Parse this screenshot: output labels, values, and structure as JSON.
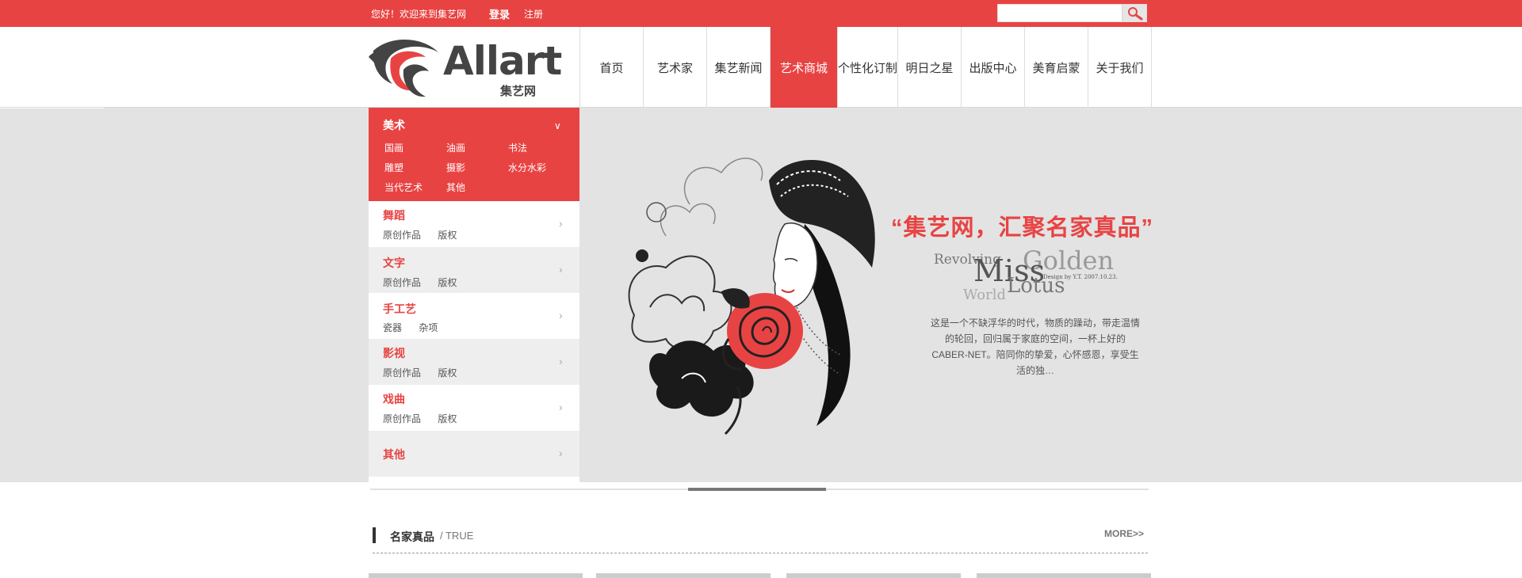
{
  "topbar": {
    "welcome": "您好！欢迎来到集艺网",
    "login": "登录",
    "register": "注册",
    "search_placeholder": ""
  },
  "logo": {
    "name": "Allart",
    "sub": "集艺网"
  },
  "nav": {
    "items": [
      {
        "label": "首页",
        "active": false
      },
      {
        "label": "艺术家",
        "active": false
      },
      {
        "label": "集艺新闻",
        "active": false
      },
      {
        "label": "艺术商城",
        "active": true
      },
      {
        "label": "个性化订制",
        "active": false
      },
      {
        "label": "明日之星",
        "active": false
      },
      {
        "label": "出版中心",
        "active": false
      },
      {
        "label": "美育启蒙",
        "active": false
      },
      {
        "label": "关于我们",
        "active": false
      }
    ]
  },
  "sidebar": {
    "main": {
      "title": "美术",
      "subs": [
        "国画",
        "油画",
        "书法",
        "雕塑",
        "摄影",
        "水分水彩",
        "当代艺术",
        "其他"
      ]
    },
    "categories": [
      {
        "title": "舞蹈",
        "subs": [
          "原创作品",
          "版权"
        ]
      },
      {
        "title": "文字",
        "subs": [
          "原创作品",
          "版权"
        ]
      },
      {
        "title": "手工艺",
        "subs": [
          "瓷器",
          "杂项"
        ]
      },
      {
        "title": "影视",
        "subs": [
          "原创作品",
          "版权"
        ]
      },
      {
        "title": "戏曲",
        "subs": [
          "原创作品",
          "版权"
        ]
      },
      {
        "title": "其他",
        "subs": []
      }
    ]
  },
  "banner": {
    "slogan": "“集艺网，汇聚名家真品”",
    "script_lines": [
      "Revolving",
      "Golden",
      "Miss",
      "Lotus",
      "World",
      "Design by Y.T. 2007.10.23."
    ],
    "description": "这是一个不缺浮华的时代，物质的躁动，带走温情的轮回，回归属于家庭的空间，一杯上好的CABER-NET。陪同你的挚爱，心怀感恩，享受生活的独…"
  },
  "section": {
    "title": "名家真品",
    "subtitle": "/ TRUE",
    "more": "MORE>>"
  },
  "colors": {
    "accent": "#e84343",
    "banner_bg": "#e3e3e3"
  }
}
